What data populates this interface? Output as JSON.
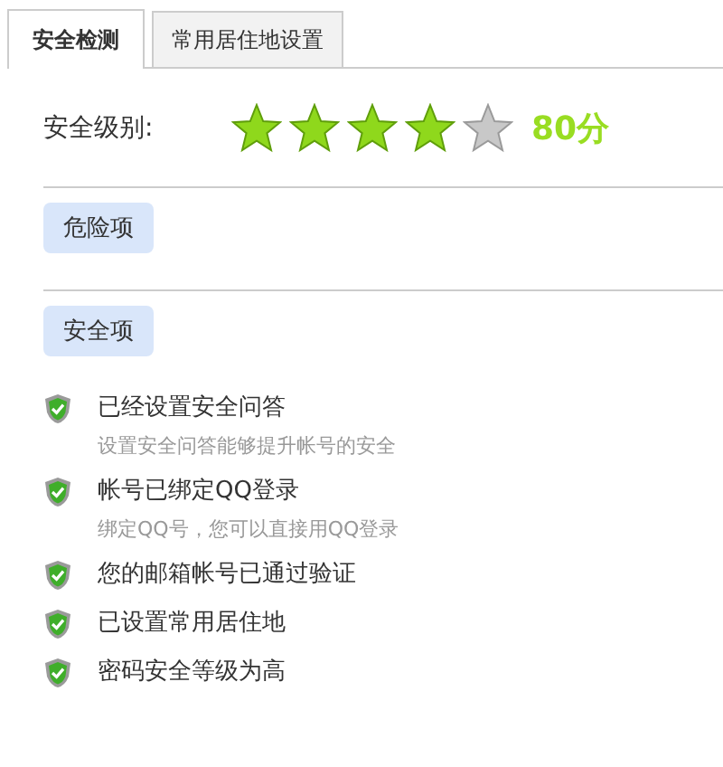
{
  "tabs": [
    {
      "label": "安全检测",
      "selected": true
    },
    {
      "label": "常用居住地设置",
      "selected": false
    }
  ],
  "security_level": {
    "label": "安全级别:",
    "stars": 4,
    "score": "80分"
  },
  "danger_section": {
    "label": "危险项"
  },
  "safe_section": {
    "label": "安全项",
    "items": [
      {
        "title": "已经设置安全问答",
        "description": "设置安全问答能够提升帐号的安全"
      },
      {
        "title": "帐号已绑定QQ登录",
        "description": "绑定QQ号，您可以直接用QQ登录"
      },
      {
        "title": "您的邮箱帐号已通过验证"
      },
      {
        "title": "已设置常用居住地"
      },
      {
        "title": "密码安全等级为高"
      }
    ]
  }
}
